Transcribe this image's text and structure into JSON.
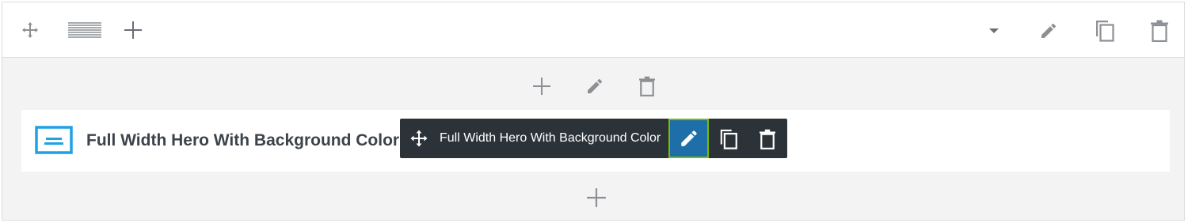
{
  "row_toolbar": {
    "left_icons": [
      "move-icon",
      "row-layout-icon",
      "add-icon"
    ],
    "right_icons": [
      "caret-down-icon",
      "pencil-icon",
      "duplicate-icon",
      "trash-icon"
    ]
  },
  "column_controls": {
    "icons": [
      "add-icon",
      "pencil-icon",
      "trash-icon"
    ]
  },
  "module": {
    "title": "Full Width Hero With Background Color",
    "icon": "module-banner-icon",
    "accent_color": "#1ea2e6"
  },
  "module_toolbar": {
    "label": "Full Width Hero With Background Color",
    "icons": [
      "move-icon",
      "pencil-icon",
      "duplicate-icon",
      "trash-icon"
    ],
    "background": "#2c3338",
    "edit_active_color": "#1e6fa8",
    "edit_focus_outline": "#7fba00"
  },
  "add_below": {
    "icon": "add-icon"
  }
}
